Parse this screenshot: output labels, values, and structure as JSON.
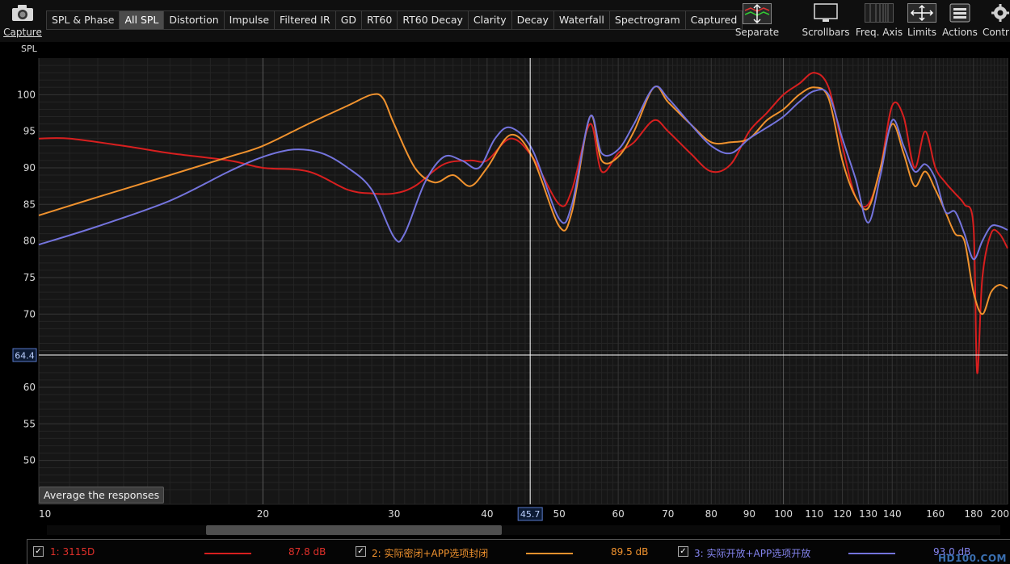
{
  "toolbar": {
    "capture_label": "Capture",
    "tabs": [
      {
        "label": "SPL & Phase",
        "active": false
      },
      {
        "label": "All SPL",
        "active": true
      },
      {
        "label": "Distortion",
        "active": false
      },
      {
        "label": "Impulse",
        "active": false
      },
      {
        "label": "Filtered IR",
        "active": false
      },
      {
        "label": "GD",
        "active": false
      },
      {
        "label": "RT60",
        "active": false
      },
      {
        "label": "RT60 Decay",
        "active": false
      },
      {
        "label": "Clarity",
        "active": false
      },
      {
        "label": "Decay",
        "active": false
      },
      {
        "label": "Waterfall",
        "active": false
      },
      {
        "label": "Spectrogram",
        "active": false
      },
      {
        "label": "Captured",
        "active": false
      }
    ],
    "separate_label": "Separate",
    "scrollbars_label": "Scrollbars",
    "freq_axis_label": "Freq. Axis",
    "limits_label": "Limits",
    "actions_label": "Actions",
    "controls_label": "Contr"
  },
  "plot": {
    "average_button_label": "Average the responses",
    "cursor": {
      "x_readout": "45.7",
      "y_readout": "64.4",
      "x_value": 45.7,
      "y_value": 64.4
    }
  },
  "chart_data": {
    "type": "line",
    "title": "",
    "ylabel": "SPL",
    "xlabel": "",
    "x_scale": "log",
    "xlim": [
      10,
      200
    ],
    "ylim": [
      44,
      105
    ],
    "grid": true,
    "x_ticks": [
      10,
      20,
      30,
      40,
      50,
      60,
      70,
      80,
      90,
      100,
      110,
      120,
      130,
      140,
      160,
      180,
      200
    ],
    "x_tick_labels": [
      "10",
      "20",
      "30",
      "40",
      "50",
      "60",
      "70",
      "80",
      "90",
      "100",
      "110",
      "120",
      "130",
      "140",
      "160",
      "180",
      "200"
    ],
    "y_ticks": [
      50,
      55,
      60,
      65,
      70,
      75,
      80,
      85,
      90,
      95,
      100
    ],
    "y_tick_labels": [
      "50",
      "55",
      "60",
      "65",
      "70",
      "75",
      "80",
      "85",
      "90",
      "95",
      "100"
    ],
    "series": [
      {
        "name": "1: 3115D",
        "color": "#d81f1f",
        "x": [
          10,
          11,
          13,
          15,
          18,
          20,
          23,
          26,
          28,
          30,
          32,
          35,
          38,
          40,
          43,
          46,
          50,
          52,
          55,
          57,
          60,
          63,
          67,
          70,
          75,
          80,
          85,
          90,
          95,
          100,
          105,
          110,
          115,
          120,
          125,
          130,
          135,
          140,
          145,
          150,
          155,
          160,
          165,
          170,
          175,
          180,
          182,
          185,
          190,
          195,
          200
        ],
        "y": [
          94,
          94,
          93,
          92,
          91,
          90,
          89.5,
          87,
          86.5,
          86.5,
          87.5,
          90.5,
          91,
          91,
          94,
          91.5,
          85,
          87,
          96,
          89.5,
          92,
          93.5,
          96.5,
          95,
          92,
          89.5,
          90.5,
          95,
          97.5,
          100,
          101.5,
          103,
          101,
          93,
          86,
          85,
          90,
          98.5,
          97,
          90,
          95,
          90,
          88,
          86.5,
          85,
          82,
          62,
          75,
          81,
          81,
          79
        ]
      },
      {
        "name": "2: 实际密闭+APP选项封闭",
        "color": "#f0922e",
        "x": [
          10,
          12,
          15,
          18,
          20,
          23,
          26,
          28,
          29,
          30,
          32,
          34,
          36,
          38,
          40,
          43,
          46,
          50,
          52,
          55,
          57,
          60,
          63,
          67,
          70,
          75,
          80,
          85,
          90,
          95,
          100,
          105,
          110,
          115,
          120,
          125,
          130,
          135,
          140,
          145,
          150,
          155,
          160,
          165,
          170,
          175,
          180,
          185,
          190,
          195,
          200
        ],
        "y": [
          83.5,
          86,
          89,
          91.5,
          93,
          96,
          98.5,
          100,
          99.5,
          96,
          90,
          88,
          89,
          87.5,
          90,
          94.5,
          91.5,
          82,
          84,
          97,
          91,
          91.5,
          95,
          101,
          99,
          96,
          93.5,
          93.5,
          94,
          96.5,
          98,
          100,
          101,
          99.5,
          91,
          86,
          84.5,
          90,
          96,
          92,
          87.5,
          89.5,
          87,
          84,
          81,
          80,
          73,
          70,
          73,
          74,
          73.5
        ]
      },
      {
        "name": "3: 实际开放+APP选项开放",
        "color": "#7474dd",
        "x": [
          10,
          12,
          15,
          18,
          20,
          22,
          24,
          26,
          28,
          30,
          31,
          33,
          35,
          37,
          39,
          41,
          43,
          46,
          50,
          52,
          55,
          57,
          60,
          63,
          67,
          70,
          75,
          80,
          85,
          90,
          95,
          100,
          105,
          110,
          115,
          120,
          125,
          130,
          135,
          140,
          145,
          150,
          155,
          160,
          165,
          170,
          175,
          180,
          185,
          190,
          195,
          200
        ],
        "y": [
          79.5,
          82,
          85.5,
          89.5,
          91.5,
          92.5,
          92,
          90,
          87,
          80.5,
          81,
          88,
          91.5,
          91,
          90,
          94,
          95.5,
          92.5,
          83,
          85,
          97,
          92,
          92.5,
          96,
          101,
          99.5,
          96,
          93,
          92,
          94,
          95.5,
          97,
          99,
          100.5,
          100,
          94,
          88.5,
          82.5,
          89,
          96.5,
          93,
          89.5,
          90.5,
          88.5,
          84,
          84,
          81,
          77.5,
          80,
          82,
          82,
          81.5
        ]
      }
    ],
    "legend": {
      "placement": "bottom",
      "entries": [
        {
          "label": "1: 3115D",
          "value": "87.8 dB",
          "checked": true
        },
        {
          "label": "2: 实际密闭+APP选项封闭",
          "value": "89.5 dB",
          "checked": true
        },
        {
          "label": "3: 实际开放+APP选项开放",
          "value": "93.0 dB",
          "checked": true
        }
      ]
    }
  },
  "watermark": "HD100.COM",
  "colors": {
    "plot_bg": "#161616",
    "grid": "#353535",
    "grid_minor": "#242424",
    "cursor": "#ffffff",
    "readout_box": "#5878c8"
  }
}
